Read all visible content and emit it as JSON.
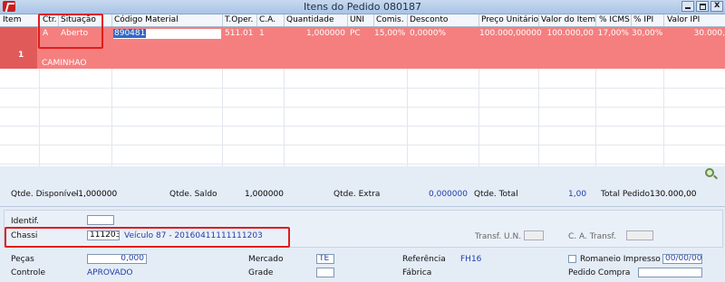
{
  "window": {
    "title": "Itens do Pedido 080187"
  },
  "grid": {
    "headers": [
      "Item",
      "Ctr.",
      "Situação",
      "Código Material",
      "T.Oper.",
      "C.A.",
      "Quantidade",
      "UNI",
      "Comis.",
      "Desconto",
      "Preço Unitário",
      "Valor do Item",
      "% ICMS",
      "% IPI",
      "Valor IPI"
    ],
    "row": {
      "item": "1",
      "ctr": "A",
      "situacao": "Aberto",
      "codigo": "890481",
      "toper": "511.01",
      "ca": "1",
      "quantidade": "1,000000",
      "uni": "PC",
      "comis": "15,00%",
      "desconto": "0,0000%",
      "preco_unitario": "100.000,00000",
      "valor_item": "100.000,00",
      "icms": "17,00%",
      "ipi": "30,00%",
      "valor_ipi": "30.000,",
      "descricao": "CAMINHAO"
    }
  },
  "totals": {
    "qtde_disponivel_label": "Qtde. Disponível",
    "qtde_disponivel": "-1,000000",
    "qtde_saldo_label": "Qtde. Saldo",
    "qtde_saldo": "1,000000",
    "qtde_extra_label": "Qtde. Extra",
    "qtde_extra": "0,000000",
    "qtde_total_label": "Qtde. Total",
    "qtde_total": "1,00",
    "total_pedido_label": "Total Pedido",
    "total_pedido": "130.000,00"
  },
  "ident": {
    "identif_label": "Identif.",
    "identif_value": "",
    "chassi_label": "Chassi",
    "chassi_value": "111203",
    "chassi_desc": "Veículo 87 - 20160411111111203",
    "transf_un_label": "Transf. U.N.",
    "ca_transf_label": "C. A. Transf."
  },
  "details": {
    "pecas_label": "Peças",
    "pecas_value": "0,000",
    "controle_label": "Controle",
    "controle_value": "APROVADO",
    "mercado_label": "Mercado",
    "mercado_value": "TE",
    "grade_label": "Grade",
    "referencia_label": "Referência",
    "referencia_value": "FH16",
    "fabrica_label": "Fábrica",
    "romaneio_label": "Romaneio Impresso",
    "romaneio_date": "00/00/00",
    "pedido_compra_label": "Pedido Compra"
  }
}
